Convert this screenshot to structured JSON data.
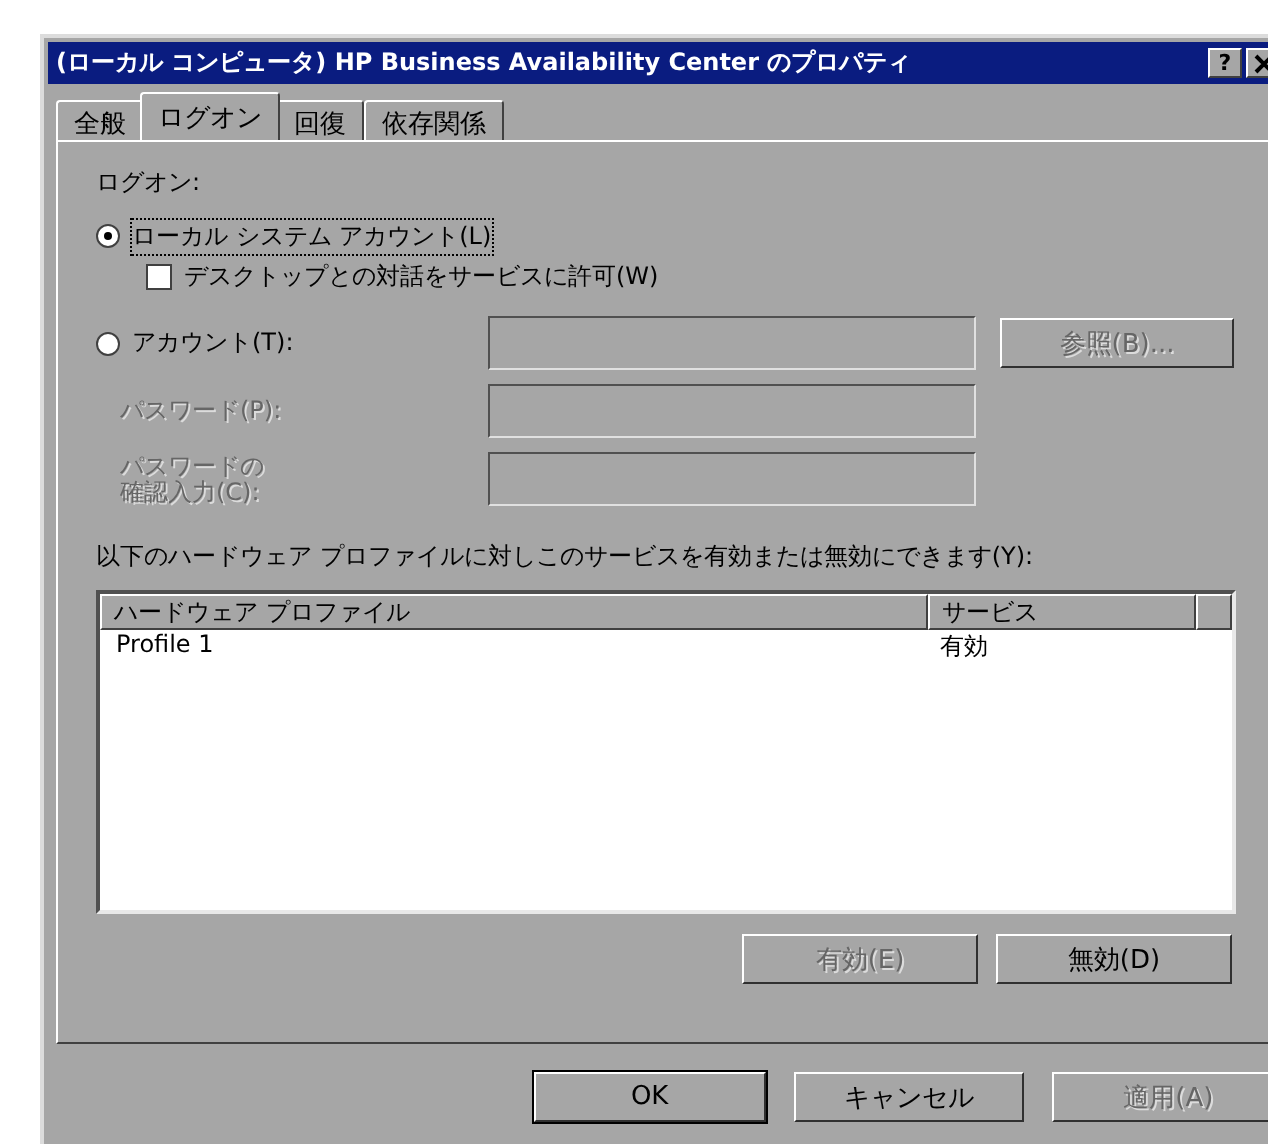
{
  "window": {
    "title": "(ローカル コンピュータ) HP Business Availability Center のプロパティ",
    "help_button": "?"
  },
  "tabs": [
    {
      "label": "全般",
      "selected": false
    },
    {
      "label": "ログオン",
      "selected": true
    },
    {
      "label": "回復",
      "selected": false
    },
    {
      "label": "依存関係",
      "selected": false
    }
  ],
  "logon": {
    "heading": "ログオン:",
    "options": [
      {
        "label": "ローカル システム アカウント(L)",
        "selected": true
      },
      {
        "label": "アカウント(T):",
        "selected": false
      }
    ],
    "interact_checkbox": {
      "label": "デスクトップとの対話をサービスに許可(W)",
      "checked": false
    },
    "browse_button": {
      "label": "参照(B)...",
      "disabled": true
    },
    "fields": [
      {
        "disabled": true
      },
      {
        "lines": [
          "パスワード(P):"
        ],
        "disabled": true
      },
      {
        "lines": [
          "パスワードの",
          "確認入力(C):"
        ],
        "disabled": true
      }
    ]
  },
  "profiles": {
    "caption": "以下のハードウェア プロファイルに対しこのサービスを有効または無効にできます(Y):",
    "columns": [
      "ハードウェア プロファイル",
      "サービス"
    ],
    "rows": [
      {
        "cells": [
          "Profile 1",
          "有効"
        ]
      }
    ],
    "buttons": [
      {
        "label": "有効(E)",
        "disabled": true
      },
      {
        "label": "無効(D)",
        "disabled": false
      }
    ]
  },
  "buttons": [
    {
      "label": "OK",
      "disabled": false,
      "default": true
    },
    {
      "label": "キャンセル",
      "disabled": false,
      "default": false
    },
    {
      "label": "適用(A)",
      "disabled": true,
      "default": false
    }
  ]
}
